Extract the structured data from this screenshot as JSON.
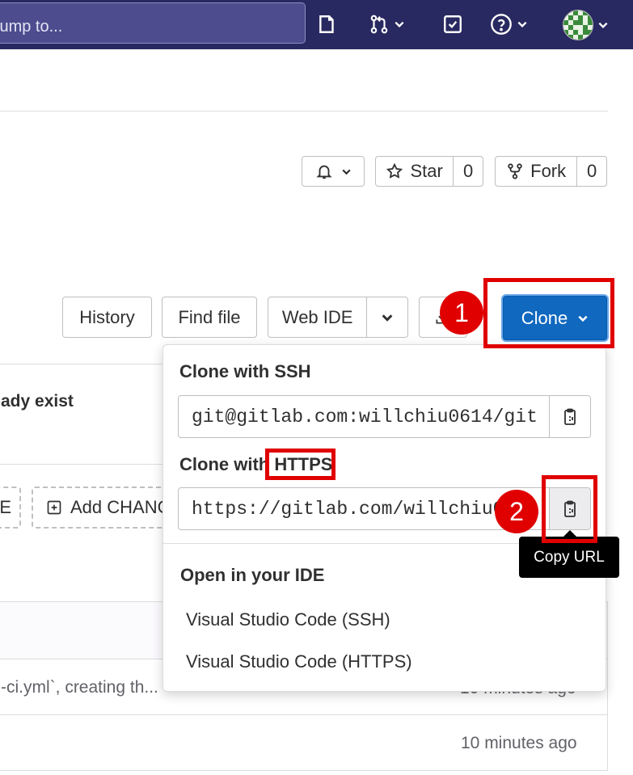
{
  "header": {
    "search_placeholder": "jump to...",
    "icons": [
      "issue-icon",
      "merge-request-icon",
      "todo-icon",
      "help-icon",
      "avatar"
    ]
  },
  "project_actions": {
    "star_label": "Star",
    "star_count": "0",
    "fork_label": "Fork",
    "fork_count": "0"
  },
  "toolbar": {
    "history_label": "History",
    "find_file_label": "Find file",
    "web_ide_label": "Web IDE",
    "clone_label": "Clone"
  },
  "background": {
    "notice_text": "ady exist",
    "left_button_text": "E",
    "add_changelog_text": "Add CHANG",
    "commit_message": "-ci.yml`, creating th...",
    "row_time_hidden": "10 minutes ago",
    "row_time": "10 minutes ago"
  },
  "clone_dropdown": {
    "ssh_heading": "Clone with SSH",
    "ssh_url": "git@gitlab.com:willchiu0614/git",
    "https_heading_prefix": "Clone with ",
    "https_heading_highlight": "HTTPS",
    "https_url": "https://gitlab.com/willchiu0",
    "ide_heading": "Open in your IDE",
    "ide_items": [
      "Visual Studio Code (SSH)",
      "Visual Studio Code (HTTPS)"
    ],
    "tooltip": "Copy URL"
  },
  "annotations": {
    "step1": "1",
    "step2": "2",
    "highlight_color": "#e00000"
  },
  "colors": {
    "nav_bg": "#292961",
    "primary": "#1068bf"
  }
}
